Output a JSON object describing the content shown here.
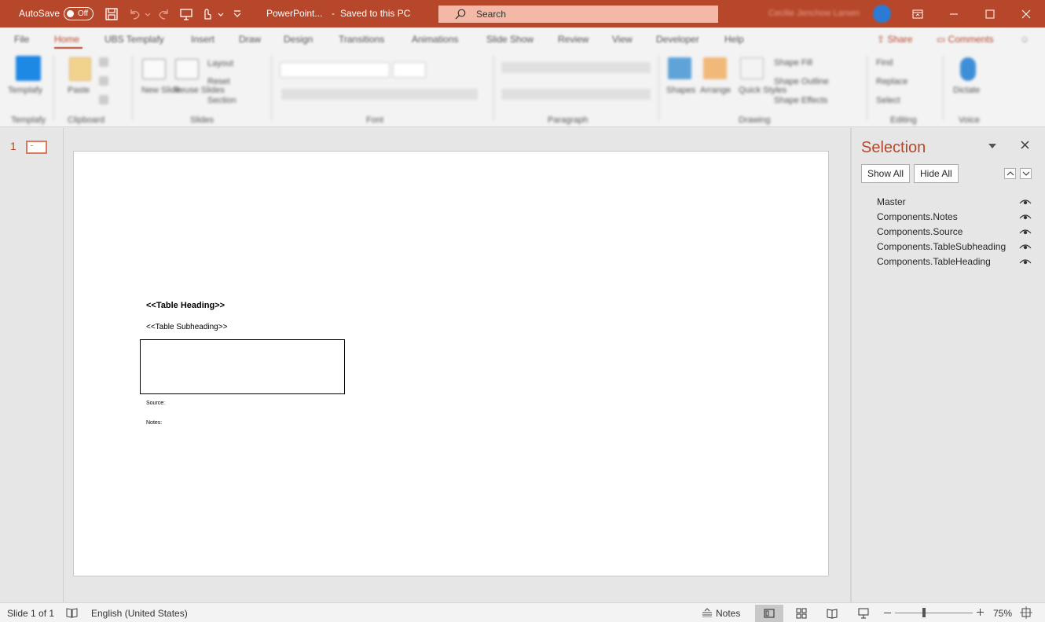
{
  "colors": {
    "accent": "#b7472a",
    "search_bg": "#f4b9a6",
    "slide_bg": "#ffffff",
    "pane_bg": "#e6e6e6"
  },
  "titlebar": {
    "autosave_label": "AutoSave",
    "autosave_state": "Off",
    "doc_title": "PowerPoint...",
    "save_status": "Saved to this PC",
    "search_placeholder": "Search",
    "user_name": "Cecilie Jenchow Larsen",
    "icons": [
      "save-icon",
      "undo-icon",
      "redo-icon",
      "presentation-icon",
      "touch-mode-icon",
      "customize-qat-icon",
      "search-icon",
      "ribbon-display-icon",
      "minimize-icon",
      "maximize-icon",
      "close-icon"
    ]
  },
  "menu": {
    "tabs": [
      "File",
      "Home",
      "UBS Templafy",
      "Insert",
      "Draw",
      "Design",
      "Transitions",
      "Animations",
      "Slide Show",
      "Review",
      "View",
      "Developer",
      "Help"
    ],
    "active_tab": "Home",
    "share_label": "Share",
    "comments_label": "Comments"
  },
  "ribbon": {
    "groups": [
      "Templafy",
      "Clipboard",
      "Slides",
      "Font",
      "Paragraph",
      "Drawing",
      "Editing",
      "Voice"
    ],
    "buttons": {
      "templafy": "Templafy",
      "paste": "Paste",
      "new_slide": "New Slide",
      "reuse_slides": "Reuse Slides",
      "layout": "Layout",
      "reset": "Reset",
      "section": "Section",
      "shapes": "Shapes",
      "arrange": "Arrange",
      "quick_styles": "Quick Styles",
      "shape_fill": "Shape Fill",
      "shape_outline": "Shape Outline",
      "shape_effects": "Shape Effects",
      "find": "Find",
      "replace": "Replace",
      "select": "Select",
      "dictate": "Dictate"
    }
  },
  "thumbnails": {
    "slide_number": "1"
  },
  "slide": {
    "table_heading": "<<Table Heading>>",
    "table_subheading": "<<Table Subheading>>",
    "source": "Source:",
    "notes": "Notes:"
  },
  "selection_pane": {
    "title": "Selection",
    "show_all": "Show All",
    "hide_all": "Hide All",
    "items": [
      "Master",
      "Components.Notes",
      "Components.Source",
      "Components.TableSubheading",
      "Components.TableHeading"
    ]
  },
  "statusbar": {
    "slide_info": "Slide 1 of 1",
    "language": "English (United States)",
    "notes_label": "Notes",
    "zoom": "75%"
  }
}
